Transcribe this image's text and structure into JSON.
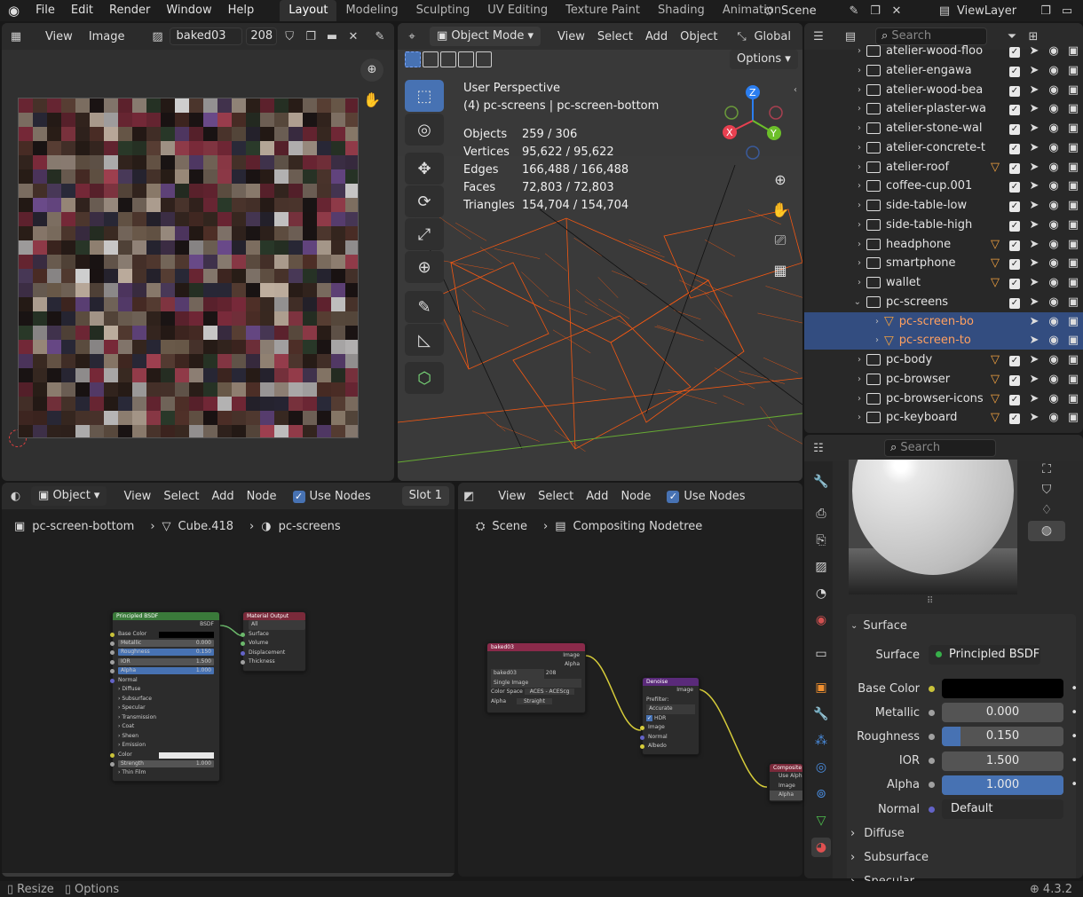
{
  "menu": [
    "File",
    "Edit",
    "Render",
    "Window",
    "Help"
  ],
  "workspaces": [
    "Layout",
    "Modeling",
    "Sculpting",
    "UV Editing",
    "Texture Paint",
    "Shading",
    "Animation"
  ],
  "scene": {
    "name": "Scene",
    "view_layer": "ViewLayer"
  },
  "image_editor": {
    "view": "View",
    "image": "Image",
    "image_name": "baked03",
    "users": "208"
  },
  "viewport": {
    "mode": "Object Mode",
    "menus": [
      "View",
      "Select",
      "Add",
      "Object"
    ],
    "orientation": "Global",
    "options": "Options",
    "perspective": "User Perspective",
    "context": "(4) pc-screens | pc-screen-bottom",
    "stats": [
      [
        "Objects",
        "259 / 306"
      ],
      [
        "Vertices",
        "95,622 / 95,622"
      ],
      [
        "Edges",
        "166,488 / 166,488"
      ],
      [
        "Faces",
        "72,803 / 72,803"
      ],
      [
        "Triangles",
        "154,704 / 154,704"
      ]
    ],
    "gizmo": {
      "x": "X",
      "y": "Y",
      "z": "Z"
    }
  },
  "outliner": {
    "search_placeholder": "Search",
    "rows": [
      {
        "name": "atelier-wood-floo",
        "mesh": false,
        "selected": false,
        "child": false,
        "open": false
      },
      {
        "name": "atelier-engawa",
        "mesh": false,
        "selected": false,
        "child": false,
        "open": false
      },
      {
        "name": "atelier-wood-bea",
        "mesh": false,
        "selected": false,
        "child": false,
        "open": false
      },
      {
        "name": "atelier-plaster-wa",
        "mesh": false,
        "selected": false,
        "child": false,
        "open": false
      },
      {
        "name": "atelier-stone-wal",
        "mesh": false,
        "selected": false,
        "child": false,
        "open": false
      },
      {
        "name": "atelier-concrete-t",
        "mesh": false,
        "selected": false,
        "child": false,
        "open": false
      },
      {
        "name": "atelier-roof",
        "mesh": true,
        "selected": false,
        "child": false,
        "open": false
      },
      {
        "name": "coffee-cup.001",
        "mesh": false,
        "selected": false,
        "child": false,
        "open": false
      },
      {
        "name": "side-table-low",
        "mesh": false,
        "selected": false,
        "child": false,
        "open": false
      },
      {
        "name": "side-table-high",
        "mesh": false,
        "selected": false,
        "child": false,
        "open": false
      },
      {
        "name": "headphone",
        "mesh": true,
        "selected": false,
        "child": false,
        "open": false
      },
      {
        "name": "smartphone",
        "mesh": true,
        "selected": false,
        "child": false,
        "open": false
      },
      {
        "name": "wallet",
        "mesh": true,
        "selected": false,
        "child": false,
        "open": false
      },
      {
        "name": "pc-screens",
        "mesh": false,
        "selected": false,
        "child": false,
        "open": true
      },
      {
        "name": "pc-screen-bo",
        "mesh": true,
        "selected": true,
        "child": true,
        "open": false
      },
      {
        "name": "pc-screen-to",
        "mesh": true,
        "selected": true,
        "child": true,
        "open": false
      },
      {
        "name": "pc-body",
        "mesh": true,
        "selected": false,
        "child": false,
        "open": false
      },
      {
        "name": "pc-browser",
        "mesh": true,
        "selected": false,
        "child": false,
        "open": false
      },
      {
        "name": "pc-browser-icons",
        "mesh": true,
        "selected": false,
        "child": false,
        "open": false
      },
      {
        "name": "pc-keyboard",
        "mesh": true,
        "selected": false,
        "child": false,
        "open": false
      }
    ]
  },
  "properties": {
    "search_placeholder": "Search",
    "panel": "Surface",
    "surface": {
      "label": "Surface",
      "value": "Principled BSDF"
    },
    "fields": [
      {
        "label": "Base Color",
        "value": "",
        "type": "color",
        "dot": "#c9c23a",
        "fill": 0
      },
      {
        "label": "Metallic",
        "value": "0.000",
        "type": "num",
        "dot": "#a0a0a0",
        "fill": 0
      },
      {
        "label": "Roughness",
        "value": "0.150",
        "type": "num",
        "dot": "#a0a0a0",
        "fill": 0.15
      },
      {
        "label": "IOR",
        "value": "1.500",
        "type": "num",
        "dot": "#a0a0a0",
        "fill": 0
      },
      {
        "label": "Alpha",
        "value": "1.000",
        "type": "num",
        "dot": "#a0a0a0",
        "fill": 1
      },
      {
        "label": "Normal",
        "value": "Default",
        "type": "enum",
        "dot": "#6363c7",
        "fill": 0
      }
    ],
    "subpanels": [
      "Diffuse",
      "Subsurface",
      "Specular"
    ]
  },
  "shader_editor": {
    "type": "Object",
    "menus": [
      "View",
      "Select",
      "Add",
      "Node"
    ],
    "use_nodes": "Use Nodes",
    "slot": "Slot 1",
    "breadcrumb": [
      "pc-screen-bottom",
      "Cube.418",
      "pc-screens"
    ],
    "bsdf": {
      "title": "Principled BSDF",
      "out": "BSDF",
      "rows": [
        "Base Color",
        "Metallic",
        "Roughness",
        "IOR",
        "Alpha",
        "Normal",
        "Diffuse",
        "Subsurface",
        "Specular",
        "Transmission",
        "Coat",
        "Sheen",
        "Emission",
        "Color",
        "Strength",
        "Thin Film"
      ],
      "vals": {
        "Metallic": "0.000",
        "Roughness": "0.150",
        "IOR": "1.500",
        "Alpha": "1.000",
        "Strength": "1.000"
      }
    },
    "matout": {
      "title": "Material Output",
      "target": "All",
      "rows": [
        "Surface",
        "Volume",
        "Displacement",
        "Thickness"
      ]
    }
  },
  "compositor": {
    "menus": [
      "View",
      "Select",
      "Add",
      "Node"
    ],
    "use_nodes": "Use Nodes",
    "breadcrumb": [
      "Scene",
      "Compositing Nodetree"
    ],
    "img": {
      "title": "baked03",
      "outs": [
        "Image",
        "Alpha"
      ],
      "name": "baked03",
      "users": "208",
      "source": "Single Image",
      "cs_label": "Color Space",
      "cs": "ACES - ACEScg",
      "alpha_label": "Alpha",
      "alpha": "Straight"
    },
    "denoise": {
      "title": "Denoise",
      "out": "Image",
      "prefilter_label": "Prefilter:",
      "prefilter": "Accurate",
      "hdr": "HDR",
      "ins": [
        "Image",
        "Normal",
        "Albedo"
      ]
    },
    "comp": {
      "title": "Composite",
      "use_alpha": "Use Alpha",
      "ins": [
        "Image",
        "Alpha"
      ]
    }
  },
  "status": {
    "left": [
      "Resize",
      "Options"
    ],
    "version": "4.3.2"
  }
}
